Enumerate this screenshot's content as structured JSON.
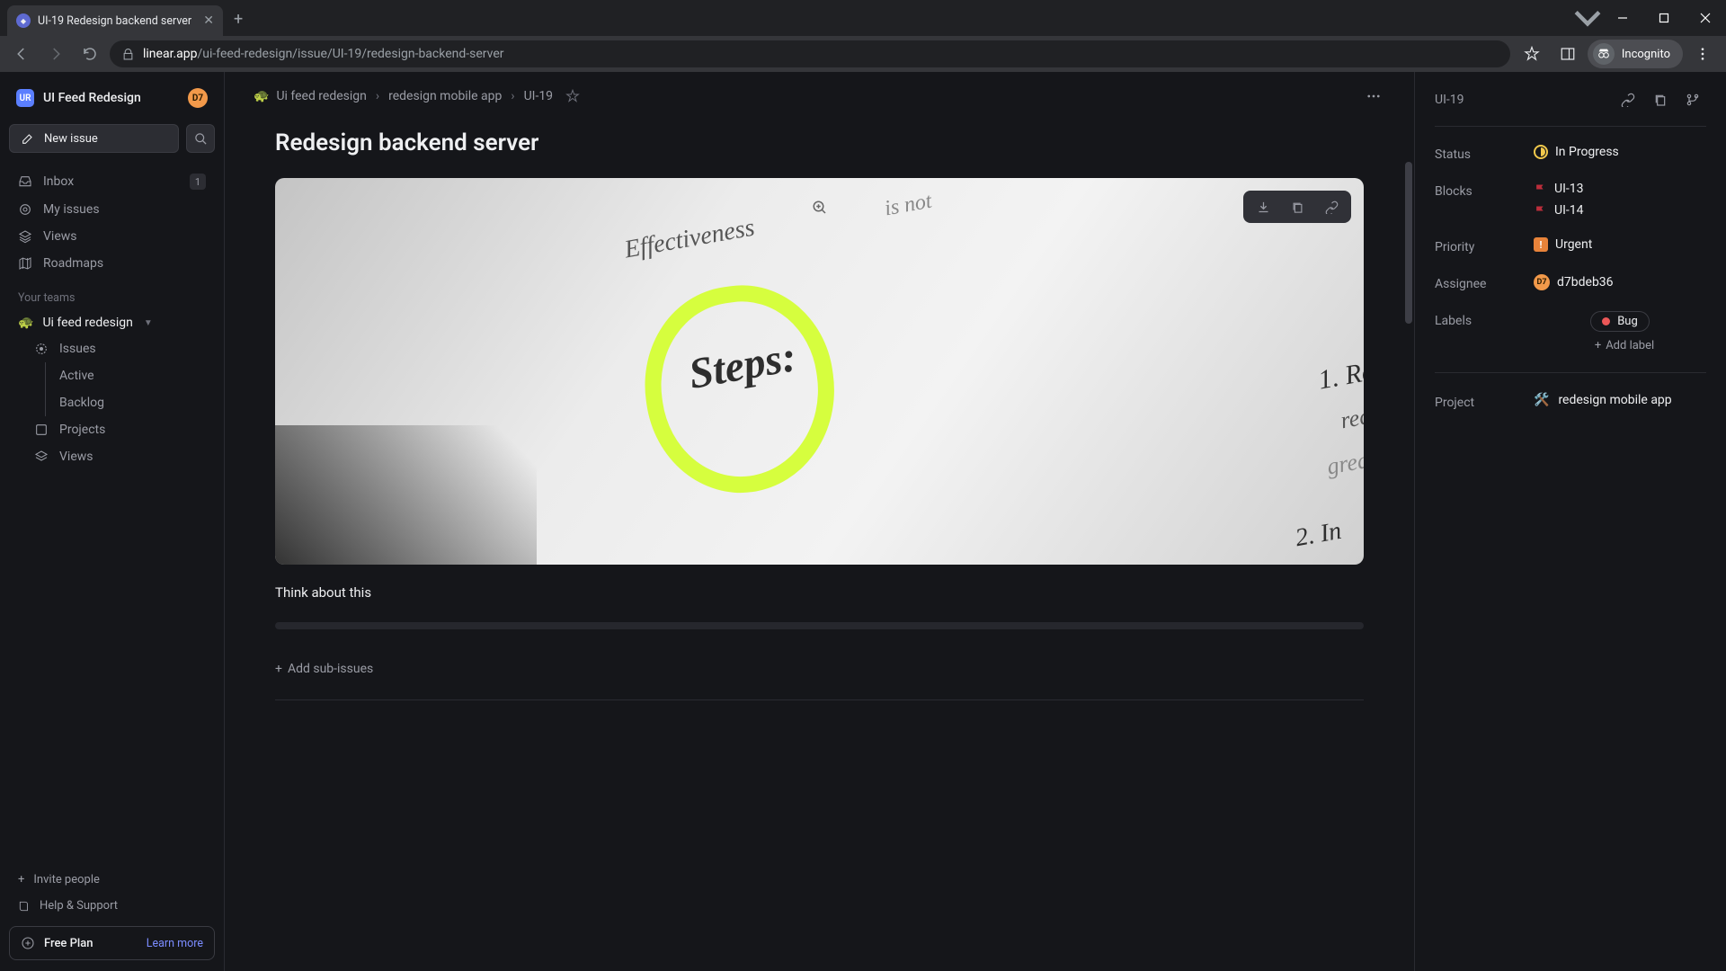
{
  "browser": {
    "tab_title": "UI-19 Redesign backend server",
    "url_host": "linear.app",
    "url_path": "/ui-feed-redesign/issue/UI-19/redesign-backend-server",
    "incognito": "Incognito"
  },
  "workspace": {
    "avatar_initials": "UR",
    "name": "UI Feed Redesign",
    "user_initials": "D7"
  },
  "sidebar": {
    "new_issue": "New issue",
    "nav": {
      "inbox": "Inbox",
      "inbox_badge": "1",
      "my_issues": "My issues",
      "views": "Views",
      "roadmaps": "Roadmaps"
    },
    "teams_label": "Your teams",
    "team": {
      "name": "Ui feed redesign",
      "emoji": "🐢",
      "issues": "Issues",
      "active": "Active",
      "backlog": "Backlog",
      "projects": "Projects",
      "views": "Views"
    },
    "footer": {
      "invite": "Invite people",
      "help": "Help & Support",
      "plan": "Free Plan",
      "learn": "Learn more"
    }
  },
  "breadcrumbs": {
    "team_emoji": "🐢",
    "team": "Ui feed redesign",
    "project": "redesign mobile app",
    "issue": "UI-19"
  },
  "issue": {
    "title": "Redesign backend server",
    "description": "Think about this",
    "add_sub": "Add sub-issues"
  },
  "panel": {
    "id": "UI-19",
    "labels": {
      "status": "Status",
      "blocks": "Blocks",
      "priority": "Priority",
      "assignee": "Assignee",
      "labels_field": "Labels",
      "project": "Project"
    },
    "values": {
      "status": "In Progress",
      "blocks": [
        "UI-13",
        "UI-14"
      ],
      "priority": "Urgent",
      "assignee": "d7bdeb36",
      "labels": [
        "Bug"
      ],
      "add_label": "Add label",
      "project_emoji": "🛠️",
      "project": "redesign mobile app"
    },
    "colors": {
      "status": "#f2c94c",
      "bug": "#eb5757",
      "flag": "#bb2d3b",
      "urgent": "#e8833a"
    }
  }
}
